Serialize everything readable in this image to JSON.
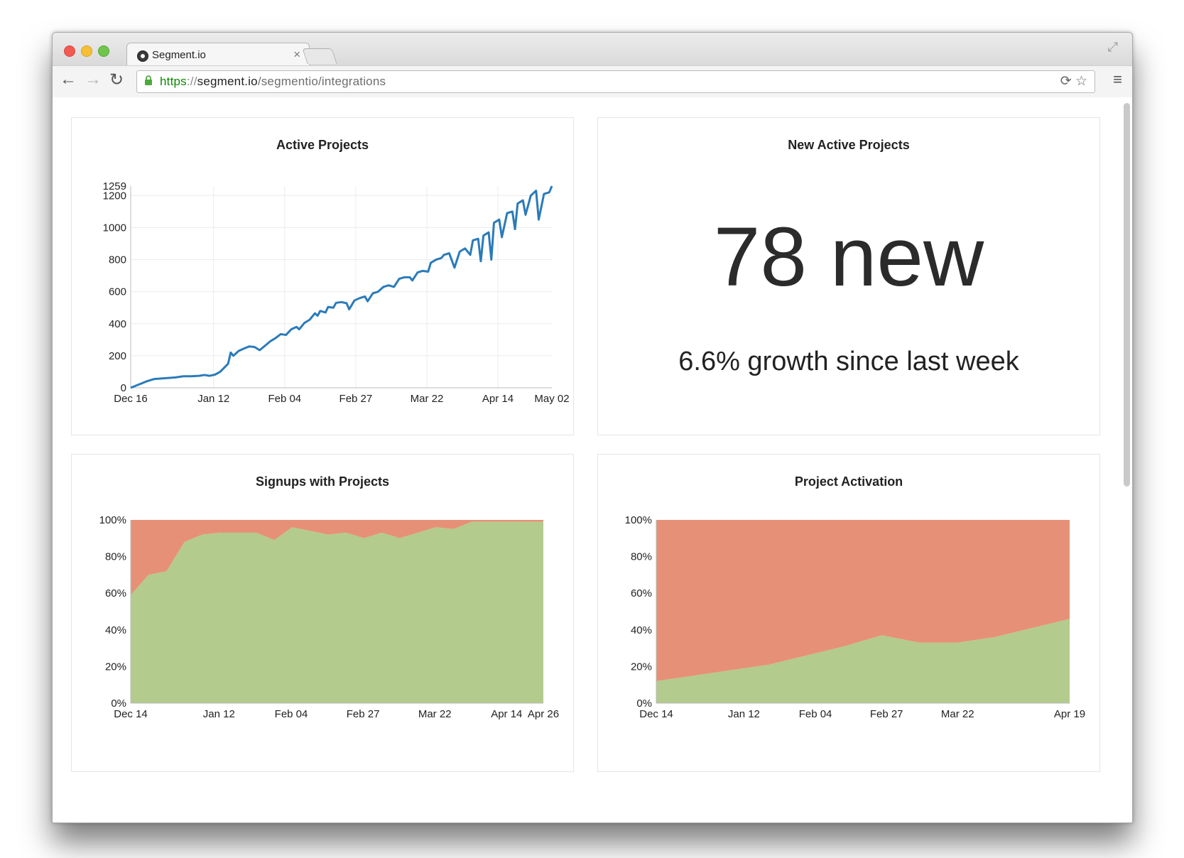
{
  "browser": {
    "tab_title": "Segment.io",
    "tab_close": "×",
    "url_proto": "https",
    "url_sep": "://",
    "url_host": "segment.io",
    "url_path": "/segmentio/integrations"
  },
  "panels": {
    "active": {
      "title": "Active Projects"
    },
    "new_active": {
      "title": "New Active Projects",
      "value": "78 new",
      "subtitle": "6.6% growth since last week"
    },
    "signups": {
      "title": "Signups with Projects"
    },
    "activation": {
      "title": "Project Activation"
    }
  },
  "colors": {
    "line": "#2b7bb9",
    "green": "#b3cb8c",
    "red": "#e69177",
    "grid": "#ececec"
  },
  "chart_data": [
    {
      "type": "line",
      "title": "Active Projects",
      "xlabel": "",
      "ylabel": "",
      "x_ticks": [
        "Dec 16",
        "Jan 12",
        "Feb 04",
        "Feb 27",
        "Mar 22",
        "Apr 14",
        "May 02"
      ],
      "x_range": [
        0,
        137
      ],
      "y_ticks": [
        0,
        200,
        400,
        600,
        800,
        1000,
        1200,
        1259
      ],
      "ylim": [
        0,
        1259
      ],
      "grid": true,
      "series": [
        {
          "values": [
            [
              0,
              0
            ],
            [
              3,
              20
            ],
            [
              6,
              40
            ],
            [
              9,
              55
            ],
            [
              13,
              60
            ],
            [
              17,
              65
            ],
            [
              20,
              72
            ],
            [
              23,
              72
            ],
            [
              26,
              75
            ],
            [
              28,
              80
            ],
            [
              30,
              75
            ],
            [
              32,
              82
            ],
            [
              34,
              100
            ],
            [
              37,
              150
            ],
            [
              38,
              220
            ],
            [
              39,
              200
            ],
            [
              41,
              230
            ],
            [
              43,
              245
            ],
            [
              45,
              258
            ],
            [
              47,
              255
            ],
            [
              49,
              235
            ],
            [
              51,
              262
            ],
            [
              53,
              290
            ],
            [
              55,
              310
            ],
            [
              57,
              335
            ],
            [
              59,
              330
            ],
            [
              61,
              365
            ],
            [
              63,
              380
            ],
            [
              64,
              365
            ],
            [
              66,
              405
            ],
            [
              68,
              425
            ],
            [
              70,
              465
            ],
            [
              71,
              450
            ],
            [
              72,
              480
            ],
            [
              74,
              470
            ],
            [
              75,
              505
            ],
            [
              77,
              500
            ],
            [
              78,
              530
            ],
            [
              80,
              535
            ],
            [
              82,
              528
            ],
            [
              83,
              490
            ],
            [
              85,
              545
            ],
            [
              87,
              560
            ],
            [
              89,
              570
            ],
            [
              90,
              540
            ],
            [
              92,
              590
            ],
            [
              94,
              600
            ],
            [
              96,
              630
            ],
            [
              98,
              640
            ],
            [
              100,
              630
            ],
            [
              102,
              680
            ],
            [
              104,
              690
            ],
            [
              106,
              690
            ],
            [
              107,
              670
            ],
            [
              109,
              720
            ],
            [
              111,
              730
            ],
            [
              113,
              725
            ],
            [
              114,
              780
            ],
            [
              116,
              800
            ],
            [
              118,
              810
            ],
            [
              119,
              830
            ],
            [
              121,
              840
            ],
            [
              123,
              750
            ],
            [
              125,
              850
            ],
            [
              127,
              870
            ],
            [
              129,
              830
            ],
            [
              130,
              920
            ],
            [
              132,
              930
            ],
            [
              133,
              790
            ],
            [
              134,
              950
            ],
            [
              136,
              970
            ],
            [
              137,
              800
            ],
            [
              138,
              1030
            ],
            [
              140,
              1050
            ],
            [
              141,
              940
            ],
            [
              143,
              1090
            ],
            [
              145,
              1100
            ],
            [
              146,
              990
            ],
            [
              147,
              1150
            ],
            [
              149,
              1170
            ],
            [
              150,
              1080
            ],
            [
              152,
              1200
            ],
            [
              154,
              1230
            ],
            [
              155,
              1050
            ],
            [
              157,
              1210
            ],
            [
              159,
              1220
            ],
            [
              160,
              1259
            ]
          ]
        }
      ]
    },
    {
      "type": "area",
      "title": "Signups with Projects",
      "xlabel": "",
      "ylabel": "",
      "x_ticks": [
        "Dec 14",
        "Jan 12",
        "Feb 04",
        "Feb 27",
        "Mar 22",
        "Apr 14",
        "Apr 26"
      ],
      "y_ticks": [
        "0%",
        "20%",
        "40%",
        "60%",
        "80%",
        "100%"
      ],
      "ylim": [
        0,
        100
      ],
      "stacked_percent": true,
      "x": [
        0,
        1,
        2,
        3,
        4,
        5,
        6,
        7,
        8,
        9,
        10,
        11,
        12,
        13,
        14,
        15,
        16,
        17,
        18,
        19,
        20,
        21,
        22,
        23
      ],
      "series": [
        {
          "values": [
            59,
            70,
            72,
            88,
            92,
            93,
            93,
            93,
            89,
            96,
            94,
            92,
            93,
            90,
            93,
            90,
            93,
            96,
            95,
            99,
            99,
            99,
            99,
            99
          ]
        },
        {
          "values": [
            41,
            30,
            28,
            12,
            8,
            7,
            7,
            7,
            11,
            4,
            6,
            8,
            7,
            10,
            7,
            10,
            7,
            4,
            5,
            1,
            1,
            1,
            1,
            1
          ]
        }
      ]
    },
    {
      "type": "area",
      "title": "Project Activation",
      "xlabel": "",
      "ylabel": "",
      "x_ticks": [
        "Dec 14",
        "Jan 12",
        "Feb 04",
        "Feb 27",
        "Mar 22",
        "Apr 19"
      ],
      "y_ticks": [
        "0%",
        "20%",
        "40%",
        "60%",
        "80%",
        "100%"
      ],
      "ylim": [
        0,
        100
      ],
      "stacked_percent": true,
      "x": [
        0,
        1,
        2,
        3,
        4,
        5,
        6,
        7,
        8,
        9,
        10,
        11
      ],
      "series": [
        {
          "values": [
            12,
            15,
            18,
            21,
            26,
            31,
            37,
            33,
            33,
            36,
            41,
            46
          ]
        },
        {
          "values": [
            88,
            85,
            82,
            79,
            74,
            69,
            63,
            67,
            67,
            64,
            59,
            54
          ]
        }
      ]
    }
  ]
}
